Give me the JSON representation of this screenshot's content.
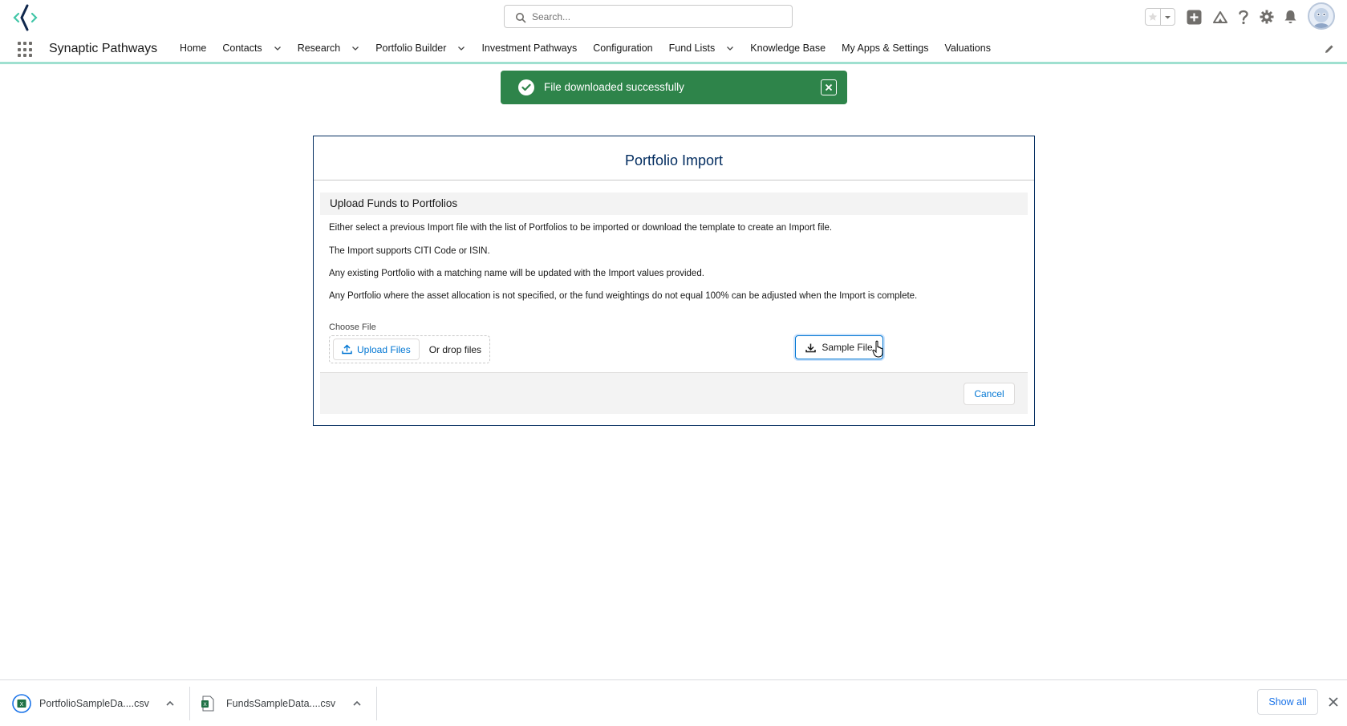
{
  "header": {
    "search_placeholder": "Search..."
  },
  "nav": {
    "app_name": "Synaptic Pathways",
    "items": [
      {
        "label": "Home",
        "has_menu": false
      },
      {
        "label": "Contacts",
        "has_menu": true
      },
      {
        "label": "Research",
        "has_menu": true
      },
      {
        "label": "Portfolio Builder",
        "has_menu": true
      },
      {
        "label": "Investment Pathways",
        "has_menu": false
      },
      {
        "label": "Configuration",
        "has_menu": false
      },
      {
        "label": "Fund Lists",
        "has_menu": true
      },
      {
        "label": "Knowledge Base",
        "has_menu": false
      },
      {
        "label": "My Apps & Settings",
        "has_menu": false
      },
      {
        "label": "Valuations",
        "has_menu": false
      }
    ]
  },
  "toast": {
    "message": "File downloaded successfully",
    "color": "#2e844a"
  },
  "modal": {
    "title": "Portfolio Import",
    "section_title": "Upload Funds to Portfolios",
    "paragraphs": [
      "Either select a previous Import file with the list of Portfolios to be imported or download the template to create an Import file.",
      "The Import supports CITI Code or ISIN.",
      "Any existing Portfolio with a matching name will be updated with the Import values provided.",
      "Any Portfolio where the asset allocation is not specified, or the fund weightings do not equal 100% can be adjusted when the Import is complete."
    ],
    "choose_file_label": "Choose File",
    "upload_label": "Upload Files",
    "drop_label": "Or drop files",
    "sample_label": "Sample File",
    "cancel_label": "Cancel"
  },
  "downloads": {
    "items": [
      {
        "name": "PortfolioSampleDa....csv"
      },
      {
        "name": "FundsSampleData....csv"
      }
    ],
    "show_all": "Show all"
  },
  "colors": {
    "brand_blue": "#0176d3",
    "navy": "#032d60",
    "nav_underline": "#9fe0d0"
  }
}
